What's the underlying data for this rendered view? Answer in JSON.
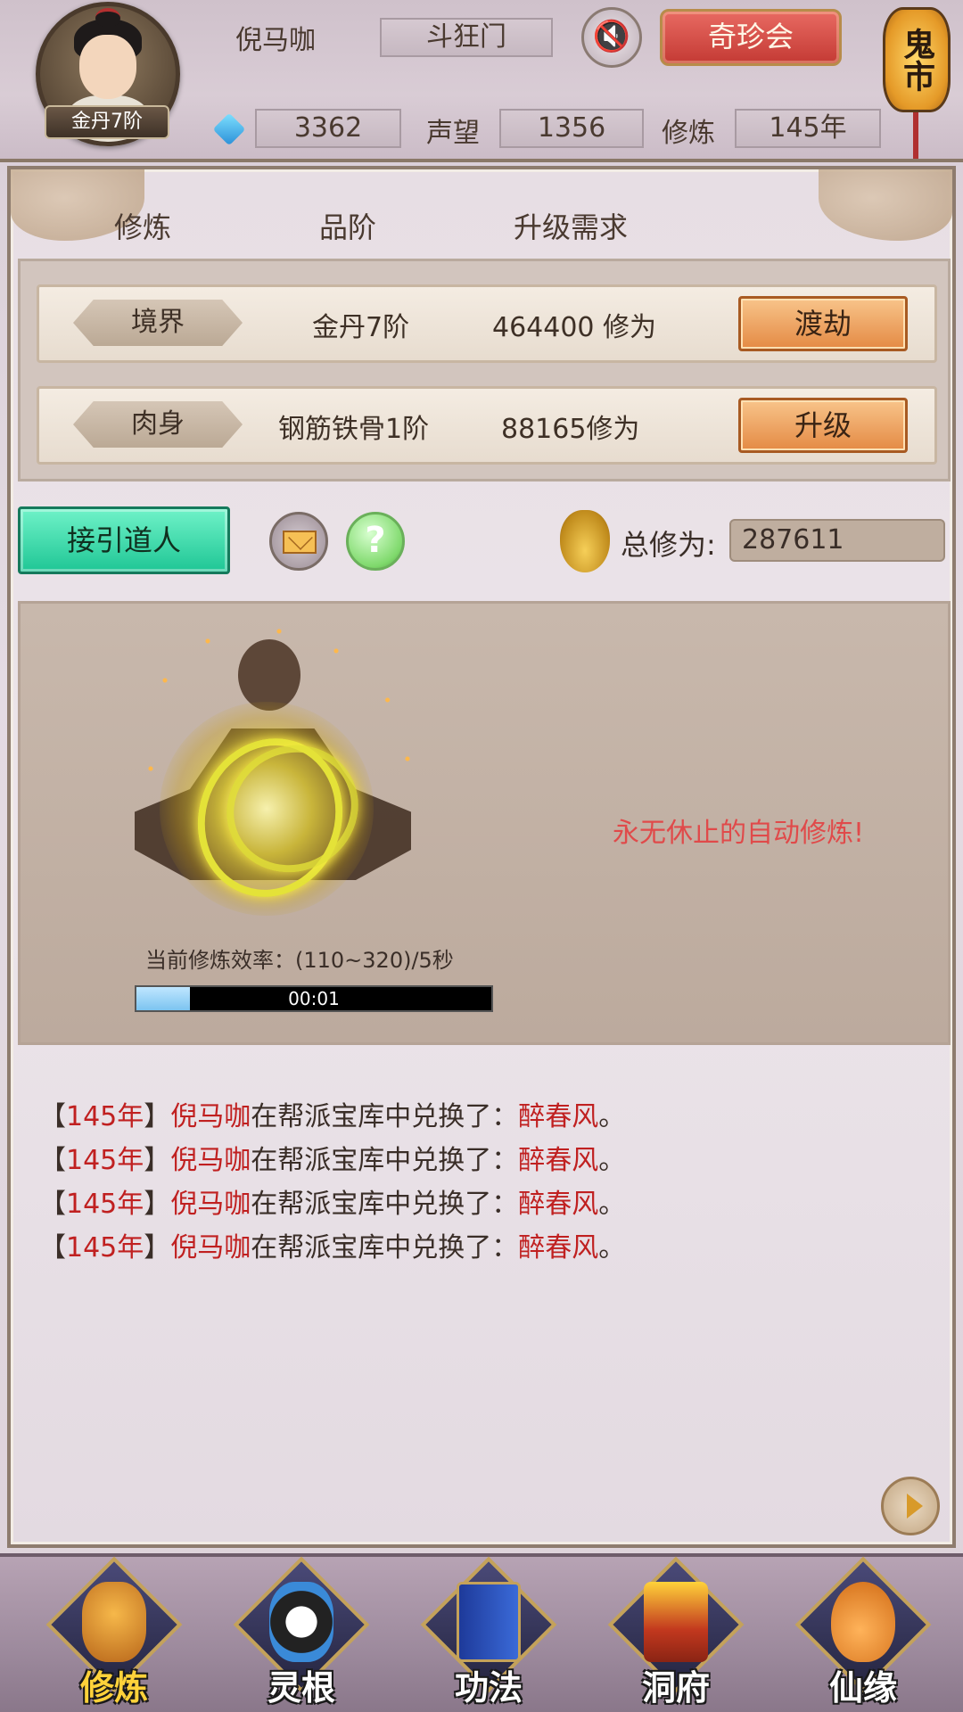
{
  "header": {
    "player_name": "倪马咖",
    "rank_badge": "金丹7阶",
    "sect": "斗狂门",
    "treasure_button": "奇珍会",
    "ghost_market": "鬼市",
    "gems": "3362",
    "reputation_label": "声望",
    "reputation": "1356",
    "cultivation_label": "修炼",
    "years": "145年"
  },
  "columns": {
    "col1": "修炼",
    "col2": "品阶",
    "col3": "升级需求"
  },
  "rows": [
    {
      "tag": "境界",
      "grade": "金丹7阶",
      "requirement": "464400 修为",
      "button": "渡劫"
    },
    {
      "tag": "肉身",
      "grade": "钢筋铁骨1阶",
      "requirement": "88165修为",
      "button": "升级"
    }
  ],
  "actions": {
    "guide_button": "接引道人",
    "help_glyph": "?",
    "total_label": "总修为:",
    "total_value": "287611"
  },
  "cultivation": {
    "auto_text": "永无休止的自动修炼!",
    "rate_text": "当前修炼效率：(110~320)/5秒",
    "progress_fraction": 0.15,
    "timer": "00:01"
  },
  "log": [
    {
      "open": "【",
      "year": "145年",
      "close": "】",
      "name": "倪马咖",
      "middle": "在帮派宝库中兑换了：",
      "item": "醉春风",
      "end": "。"
    },
    {
      "open": "【",
      "year": "145年",
      "close": "】",
      "name": "倪马咖",
      "middle": "在帮派宝库中兑换了：",
      "item": "醉春风",
      "end": "。"
    },
    {
      "open": "【",
      "year": "145年",
      "close": "】",
      "name": "倪马咖",
      "middle": "在帮派宝库中兑换了：",
      "item": "醉春风",
      "end": "。"
    },
    {
      "open": "【",
      "year": "145年",
      "close": "】",
      "name": "倪马咖",
      "middle": "在帮派宝库中兑换了：",
      "item": "醉春风",
      "end": "。"
    }
  ],
  "nav": [
    {
      "label": "修炼",
      "icon": "meditating-figure-icon",
      "active": true
    },
    {
      "label": "灵根",
      "icon": "yin-yang-sword-icon",
      "active": false
    },
    {
      "label": "功法",
      "icon": "scroll-book-icon",
      "active": false
    },
    {
      "label": "洞府",
      "icon": "pagoda-icon",
      "active": false
    },
    {
      "label": "仙缘",
      "icon": "gourd-icon",
      "active": false
    }
  ],
  "colors": {
    "accent_red": "#c02020",
    "guide_green": "#1fc695",
    "upgrade_orange": "#e48a44"
  }
}
